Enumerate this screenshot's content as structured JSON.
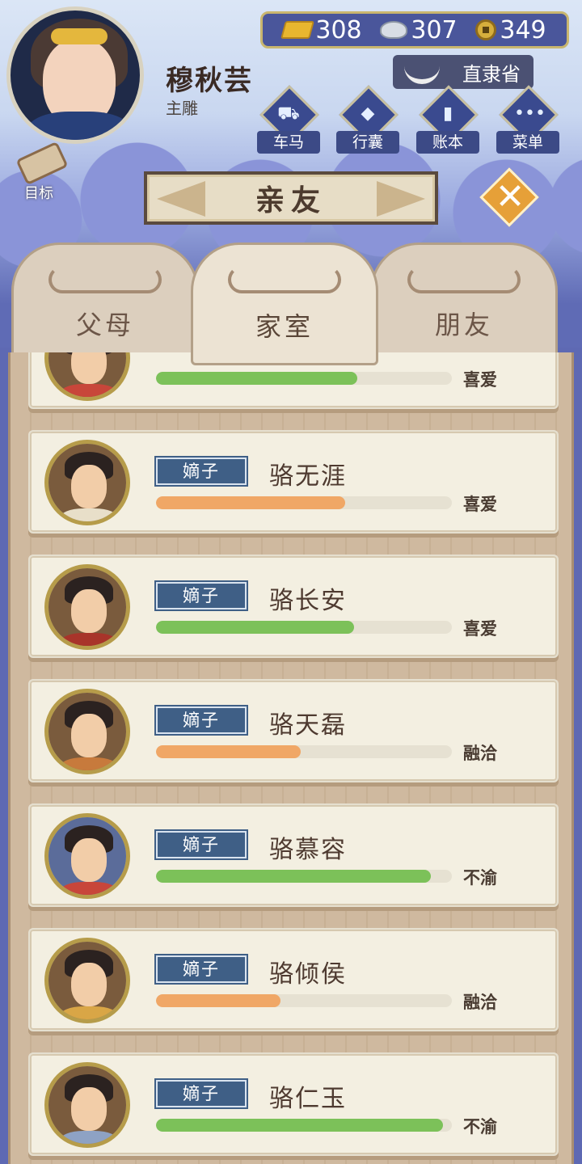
{
  "header": {
    "player_name": "穆秋芸",
    "player_title": "主雕",
    "goal_label": "目标",
    "region": "直隶省"
  },
  "currency": {
    "gold": "308",
    "silver": "307",
    "copper": "349"
  },
  "menu": [
    {
      "label": "车马",
      "icon": "carriage-icon"
    },
    {
      "label": "行囊",
      "icon": "bag-icon"
    },
    {
      "label": "账本",
      "icon": "ledger-icon"
    },
    {
      "label": "菜单",
      "icon": "more-icon"
    }
  ],
  "title": "亲友",
  "tabs": [
    {
      "label": "父母",
      "active": false
    },
    {
      "label": "家室",
      "active": true
    },
    {
      "label": "朋友",
      "active": false
    }
  ],
  "colors": {
    "bar_green": "#7cc159",
    "bar_orange": "#f0a766",
    "tag_blue": "#3f5f86"
  },
  "list": [
    {
      "tag": "",
      "name": "",
      "relation": "喜爱",
      "progress": 0.68,
      "bar": "green"
    },
    {
      "tag": "嫡子",
      "name": "骆无涯",
      "relation": "喜爱",
      "progress": 0.64,
      "bar": "orange"
    },
    {
      "tag": "嫡子",
      "name": "骆长安",
      "relation": "喜爱",
      "progress": 0.67,
      "bar": "green"
    },
    {
      "tag": "嫡子",
      "name": "骆天磊",
      "relation": "融洽",
      "progress": 0.49,
      "bar": "orange"
    },
    {
      "tag": "嫡子",
      "name": "骆慕容",
      "relation": "不渝",
      "progress": 0.93,
      "bar": "green"
    },
    {
      "tag": "嫡子",
      "name": "骆倾侯",
      "relation": "融洽",
      "progress": 0.42,
      "bar": "orange"
    },
    {
      "tag": "嫡子",
      "name": "骆仁玉",
      "relation": "不渝",
      "progress": 0.97,
      "bar": "green"
    }
  ]
}
